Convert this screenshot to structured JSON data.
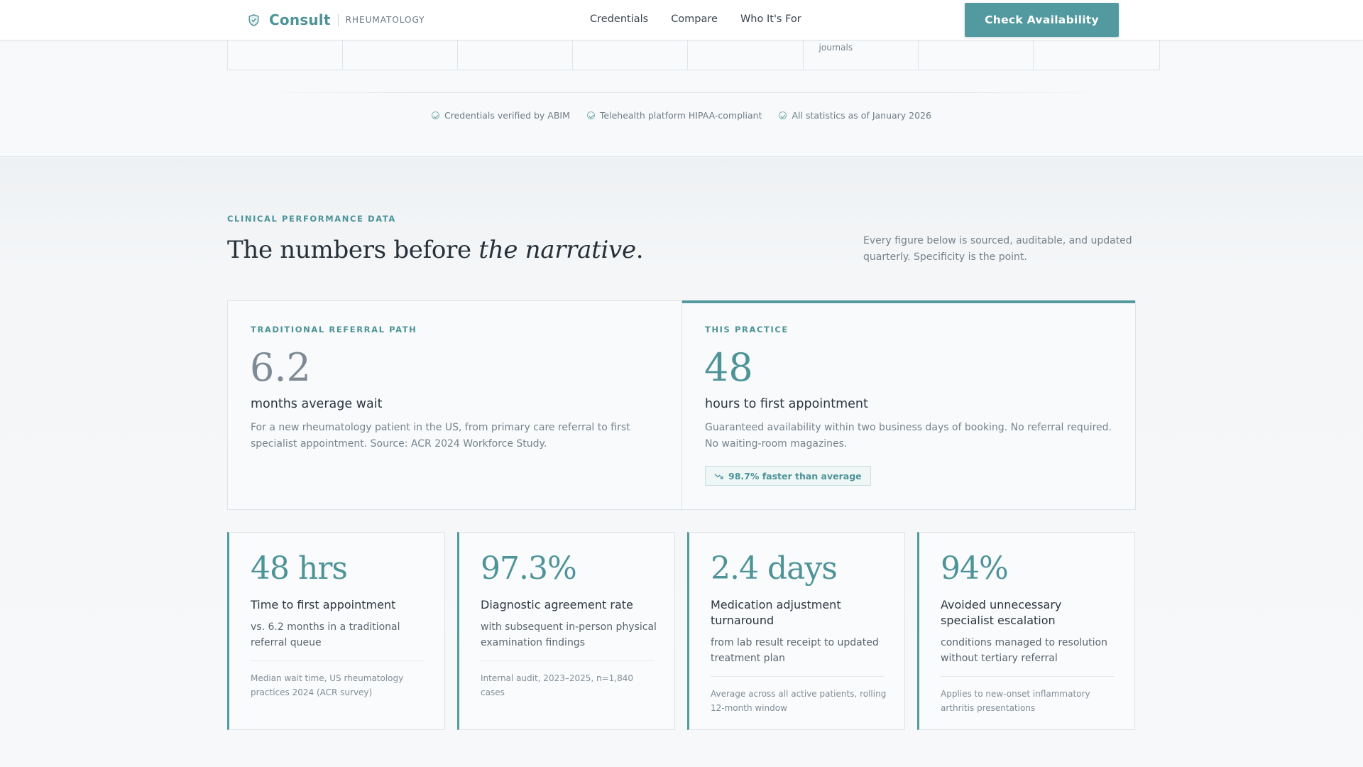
{
  "nav": {
    "brand": "Consult",
    "brand_sub": "RHEUMATOLOGY",
    "links": [
      "Credentials",
      "Compare",
      "Who It's For"
    ],
    "cta": "Check Availability"
  },
  "credentials_strip": {
    "visible_fragment": "journals"
  },
  "trust": {
    "items": [
      "Credentials verified by ABIM",
      "Telehealth platform HIPAA-compliant",
      "All statistics as of January 2026"
    ]
  },
  "performance": {
    "eyebrow": "CLINICAL PERFORMANCE DATA",
    "title_plain": "The numbers before ",
    "title_italic": "the narrative",
    "title_end": ".",
    "note": "Every figure below is sourced, auditable, and updated quarterly. Specificity is the point.",
    "traditional": {
      "eyebrow": "TRADITIONAL REFERRAL PATH",
      "value": "6.2",
      "label": "months average wait",
      "description": "For a new rheumatology patient in the US, from primary care referral to first specialist appointment. Source: ACR 2024 Workforce Study."
    },
    "practice": {
      "eyebrow": "THIS PRACTICE",
      "value": "48",
      "label": "hours to first appointment",
      "description": "Guaranteed availability within two business days of booking. No referral required. No waiting-room magazines.",
      "badge": "98.7% faster than average"
    },
    "stats": [
      {
        "value": "48 hrs",
        "title": "Time to first appointment",
        "desc": "vs. 6.2 months in a traditional referral queue",
        "footnote": "Median wait time, US rheumatology practices 2024 (ACR survey)"
      },
      {
        "value": "97.3%",
        "title": "Diagnostic agreement rate",
        "desc": "with subsequent in-person physical examination findings",
        "footnote": "Internal audit, 2023–2025, n=1,840 cases"
      },
      {
        "value": "2.4 days",
        "title": "Medication adjustment turnaround",
        "desc": "from lab result receipt to updated treatment plan",
        "footnote": "Average across all active patients, rolling 12-month window"
      },
      {
        "value": "94%",
        "title": "Avoided unnecessary specialist escalation",
        "desc": "conditions managed to resolution without tertiary referral",
        "footnote": "Applies to new-onset inflammatory arthritis presentations"
      }
    ]
  },
  "colors": {
    "accent": "#529a9f",
    "accent_text": "#4e9398",
    "muted_number": "#7e8a95",
    "heading": "#25303a"
  }
}
